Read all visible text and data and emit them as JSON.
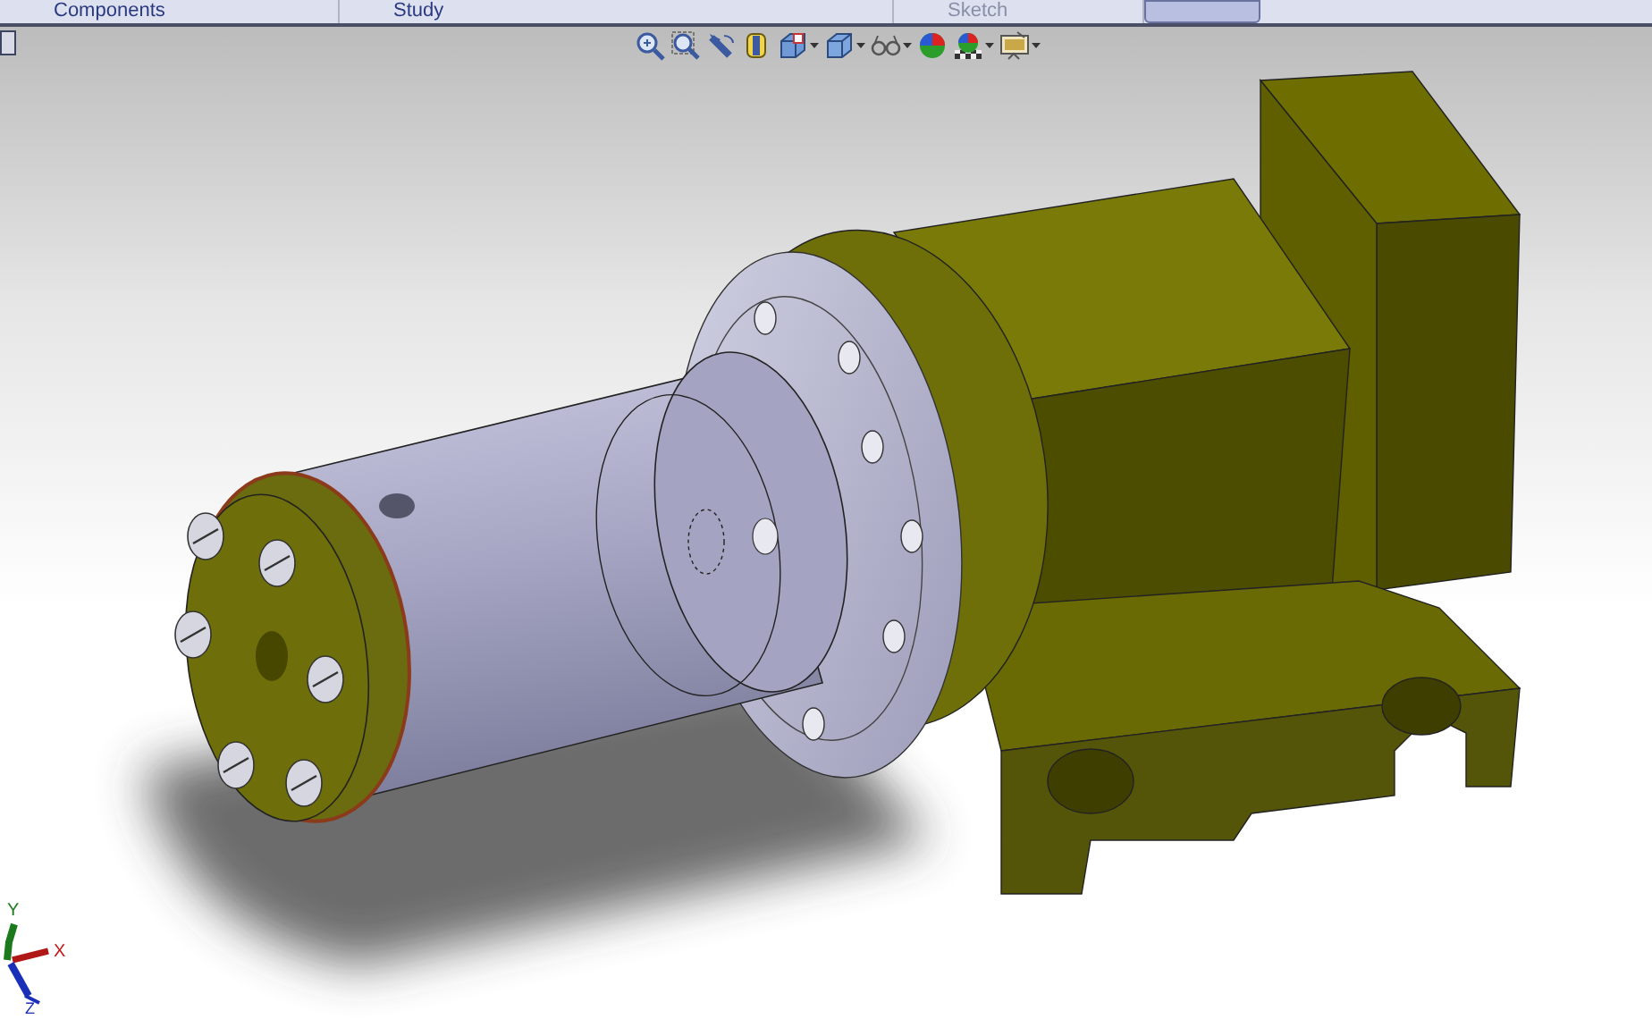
{
  "tabs": [
    {
      "label": "Components",
      "selected": false
    },
    {
      "label": "Study",
      "selected": false
    },
    {
      "label": "Sketch",
      "selected": false
    },
    {
      "selected": true
    }
  ],
  "view_toolbar": [
    {
      "kind": "zoom-fit",
      "dropdown": false
    },
    {
      "kind": "zoom-area",
      "dropdown": false
    },
    {
      "kind": "previous-view",
      "dropdown": false
    },
    {
      "kind": "section",
      "dropdown": false
    },
    {
      "kind": "orientation",
      "dropdown": true
    },
    {
      "kind": "display-style",
      "dropdown": true
    },
    {
      "kind": "hide-show",
      "dropdown": true
    },
    {
      "kind": "appearance",
      "dropdown": false
    },
    {
      "kind": "scene",
      "dropdown": true
    },
    {
      "kind": "view-settings",
      "dropdown": true
    }
  ],
  "triad": {
    "x": "X",
    "y": "Y",
    "z": "Z"
  }
}
